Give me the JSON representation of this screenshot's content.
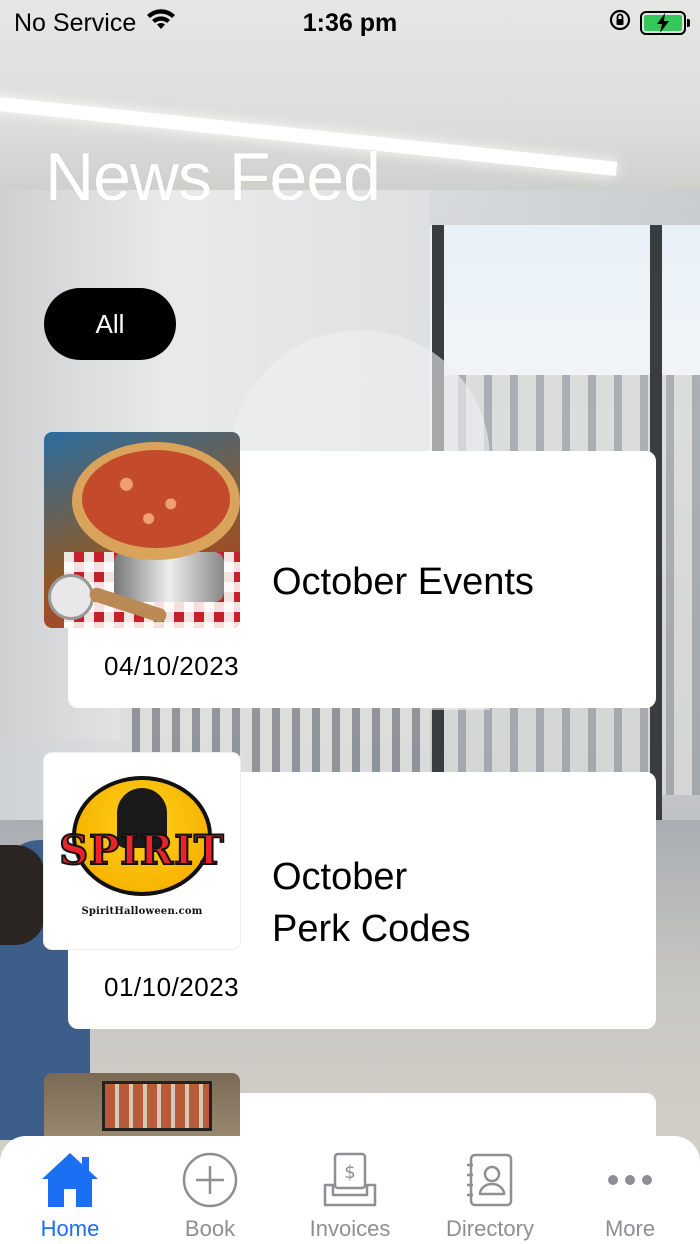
{
  "status_bar": {
    "carrier": "No Service",
    "time": "1:36 pm"
  },
  "page": {
    "title": "News Feed"
  },
  "filters": {
    "active": "All"
  },
  "feed": [
    {
      "title": "October Events",
      "date": "04/10/2023",
      "thumb": "pizza-image"
    },
    {
      "title": "October\nPerk Codes",
      "date": "01/10/2023",
      "thumb": "spirit-halloween-logo"
    }
  ],
  "spirit_logo": {
    "word": "SPIRIT",
    "url": "SpiritHalloween.com"
  },
  "tab_bar": {
    "tabs": [
      {
        "label": "Home",
        "icon": "house-icon",
        "active": true
      },
      {
        "label": "Book",
        "icon": "plus-circle-icon",
        "active": false
      },
      {
        "label": "Invoices",
        "icon": "invoice-tray-icon",
        "active": false
      },
      {
        "label": "Directory",
        "icon": "contact-book-icon",
        "active": false
      },
      {
        "label": "More",
        "icon": "ellipsis-icon",
        "active": false
      }
    ]
  },
  "colors": {
    "accent": "#1b6ff2",
    "inactive": "#8e8e93",
    "battery": "#34c759",
    "chip_bg": "#000000"
  }
}
